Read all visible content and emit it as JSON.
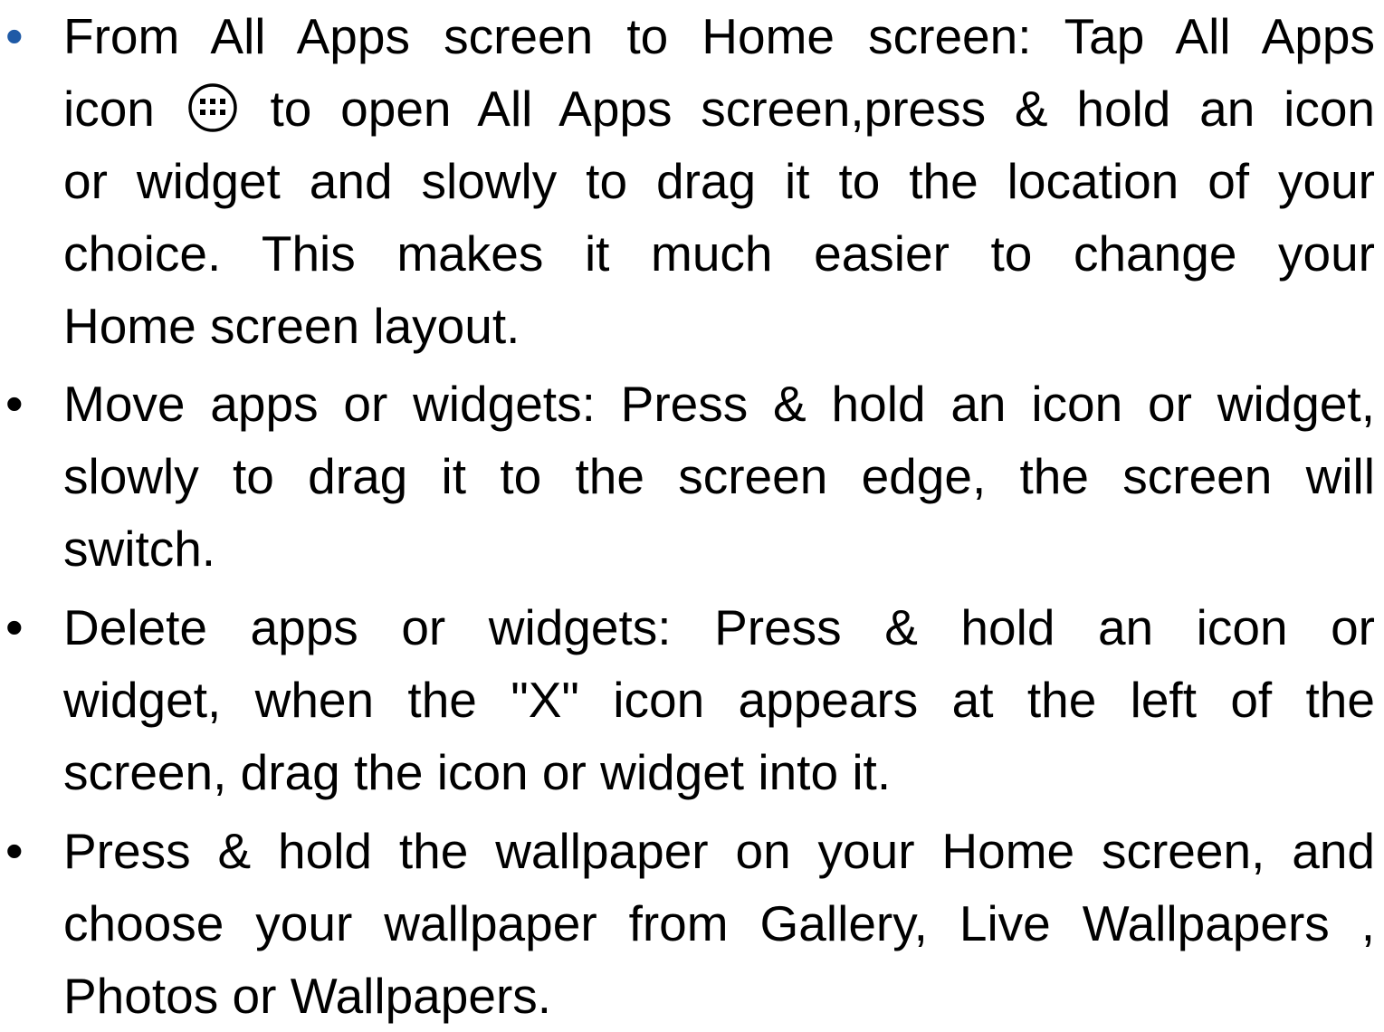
{
  "document": {
    "bullet_symbol": "•",
    "bullet_accent_color": "#1f5aa6",
    "text_color": "#000000",
    "items": [
      {
        "lines": [
          "From All Apps screen to Home screen: Tap All Apps",
          [
            "icon",
            "all-apps-icon",
            "to open All Apps screen,press & hold an icon"
          ],
          "or widget and slowly to drag it to the location of your",
          "choice. This makes it much easier to change your",
          "Home screen layout."
        ]
      },
      {
        "lines": [
          "Move apps or widgets: Press & hold an icon or widget,",
          "slowly to drag it to the screen edge, the screen will",
          "switch."
        ]
      },
      {
        "lines": [
          "Delete apps or widgets: Press & hold an icon or",
          "widget, when the \"X\" icon appears at the left of the",
          "screen, drag the icon or widget into it."
        ]
      },
      {
        "lines": [
          "Press & hold the wallpaper on your Home screen, and",
          "choose your wallpaper from Gallery, Live Wallpapers ,",
          "Photos or Wallpapers."
        ]
      }
    ]
  },
  "b1": {
    "l1": "From All Apps screen to Home screen: Tap All Apps",
    "l2a": "icon",
    "l2b": "to open All Apps screen,press & hold an icon",
    "l3": "or widget and slowly to drag it to the location of your",
    "l4": "choice. This makes it much easier to change your",
    "l5": "Home screen layout."
  },
  "b2": {
    "l1": "Move apps or widgets: Press & hold an icon or widget,",
    "l2": "slowly to drag it to the screen edge, the screen will",
    "l3": "switch."
  },
  "b3": {
    "l1": "Delete apps or widgets: Press & hold an icon or",
    "l2": "widget, when the \"X\" icon appears at the left of the",
    "l3": "screen, drag the icon or widget into it."
  },
  "b4": {
    "l1": "Press & hold the wallpaper on your Home screen, and",
    "l2": "choose your wallpaper from Gallery, Live Wallpapers ,",
    "l3": "Photos or Wallpapers."
  },
  "icons": {
    "all_apps": "all-apps-icon"
  }
}
